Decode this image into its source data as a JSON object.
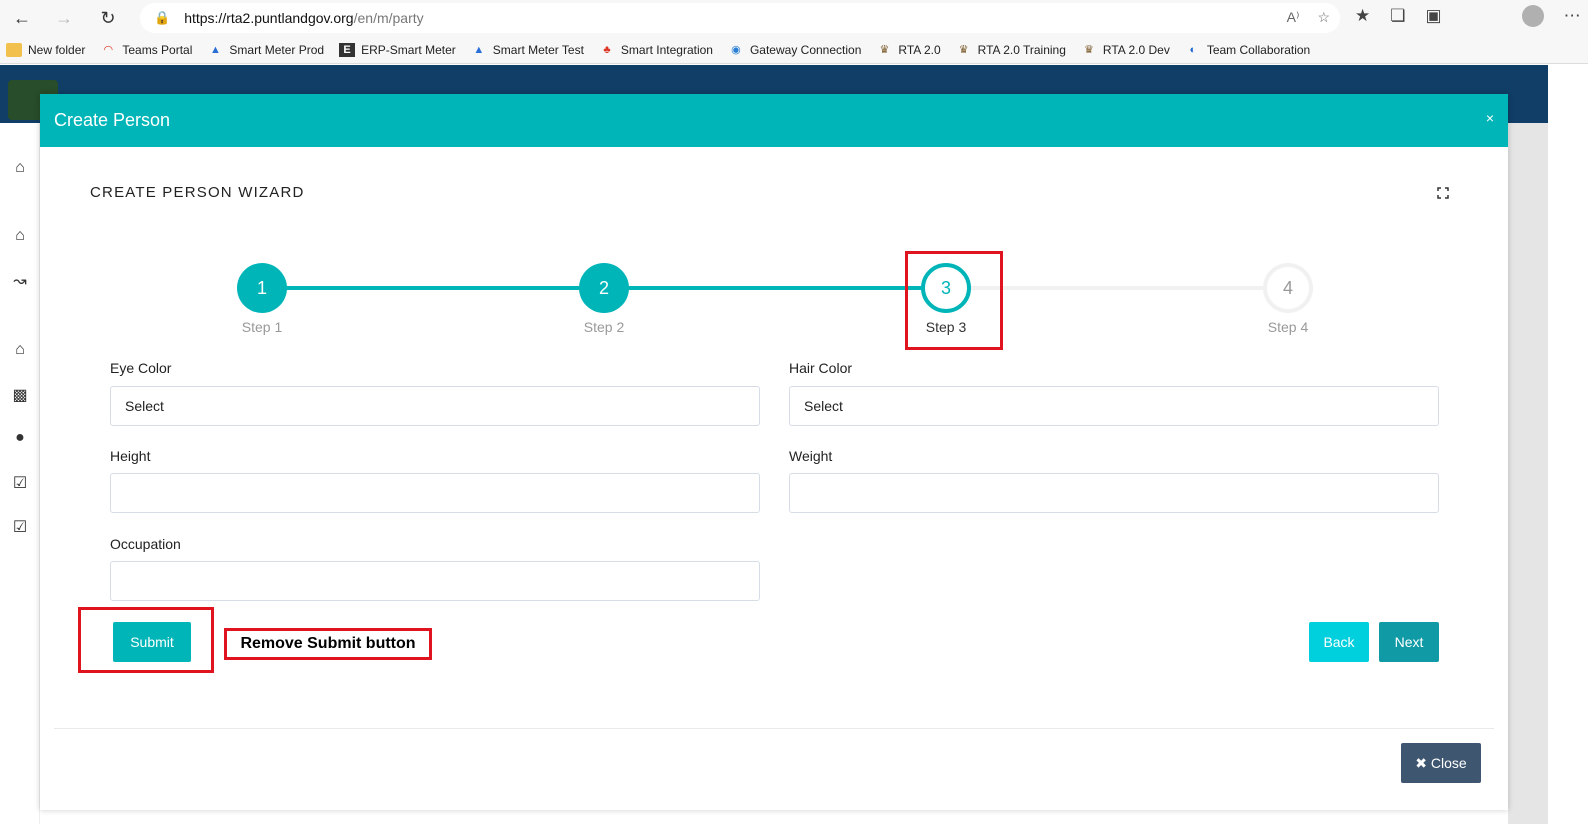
{
  "browser": {
    "back_icon": "arrow-left-icon",
    "forward_icon": "arrow-right-icon",
    "refresh_icon": "refresh-icon",
    "url_host": "https://rta2.puntlandgov.org",
    "url_path": "/en/m/party",
    "read_aloud": "A⁾",
    "bookmarks": [
      {
        "label": "New folder"
      },
      {
        "label": "Teams Portal"
      },
      {
        "label": "Smart Meter Prod"
      },
      {
        "label": "ERP-Smart Meter"
      },
      {
        "label": "Smart Meter Test"
      },
      {
        "label": "Smart Integration"
      },
      {
        "label": "Gateway Connection"
      },
      {
        "label": "RTA 2.0"
      },
      {
        "label": "RTA 2.0 Training"
      },
      {
        "label": "RTA 2.0 Dev"
      },
      {
        "label": "Team Collaboration"
      }
    ]
  },
  "modal": {
    "title": "Create Person",
    "close_x": "×",
    "wizard_title": "CREATE PERSON WIZARD",
    "steps": [
      {
        "number": "1",
        "label": "Step 1",
        "state": "done"
      },
      {
        "number": "2",
        "label": "Step 2",
        "state": "done"
      },
      {
        "number": "3",
        "label": "Step 3",
        "state": "current"
      },
      {
        "number": "4",
        "label": "Step 4",
        "state": "todo"
      }
    ],
    "fields": {
      "eye_color": {
        "label": "Eye Color",
        "value": "Select"
      },
      "hair_color": {
        "label": "Hair Color",
        "value": "Select"
      },
      "height": {
        "label": "Height",
        "value": ""
      },
      "weight": {
        "label": "Weight",
        "value": ""
      },
      "occupation": {
        "label": "Occupation",
        "value": ""
      }
    },
    "submit_label": "Submit",
    "back_label": "Back",
    "next_label": "Next",
    "close_label": "✖ Close"
  },
  "annotation": {
    "remove_note": "Remove Submit button"
  },
  "colors": {
    "accent": "#00b5b8",
    "annotation_red": "#e0141e",
    "app_header": "#103e66",
    "close_button": "#3f5670"
  }
}
